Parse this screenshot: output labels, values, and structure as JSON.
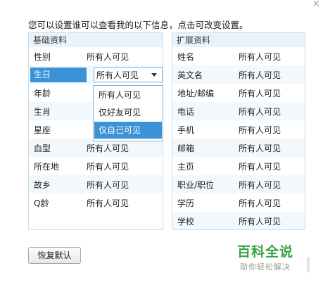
{
  "close_glyph": "×",
  "intro": "您可以设置谁可以查看我的以下信息，点击可改变设置。",
  "basic": {
    "title": "基础资料",
    "rows": [
      {
        "field": "性别",
        "value": "所有人可见"
      },
      {
        "field": "生日",
        "value": "所有人可见"
      },
      {
        "field": "年龄",
        "value": ""
      },
      {
        "field": "生肖",
        "value": ""
      },
      {
        "field": "星座",
        "value": ""
      },
      {
        "field": "血型",
        "value": "所有人可见"
      },
      {
        "field": "所在地",
        "value": "所有人可见"
      },
      {
        "field": "故乡",
        "value": "所有人可见"
      },
      {
        "field": "Q龄",
        "value": "所有人可见"
      }
    ]
  },
  "dropdown": {
    "options": [
      "所有人可见",
      "仅好友可见",
      "仅自己可见"
    ],
    "highlighted": "仅自己可见"
  },
  "extended": {
    "title": "扩展资料",
    "rows": [
      {
        "field": "姓名",
        "value": "所有人可见"
      },
      {
        "field": "英文名",
        "value": "所有人可见"
      },
      {
        "field": "地址/邮编",
        "value": "所有人可见"
      },
      {
        "field": "电话",
        "value": "所有人可见"
      },
      {
        "field": "手机",
        "value": "所有人可见"
      },
      {
        "field": "邮箱",
        "value": "所有人可见"
      },
      {
        "field": "主页",
        "value": "所有人可见"
      },
      {
        "field": "职业/职位",
        "value": "所有人可见"
      },
      {
        "field": "学历",
        "value": "所有人可见"
      },
      {
        "field": "学校",
        "value": "所有人可见"
      }
    ]
  },
  "restore_button": "恢复默认",
  "watermark": {
    "logo": "百科全说",
    "slogan": "助你轻松解决"
  },
  "colors": {
    "accent": "#3c92d6",
    "panel_header": "#eaf3fa",
    "row_alt": "#f2f8fc",
    "border": "#cfdde9",
    "watermark": "#3aa244"
  }
}
